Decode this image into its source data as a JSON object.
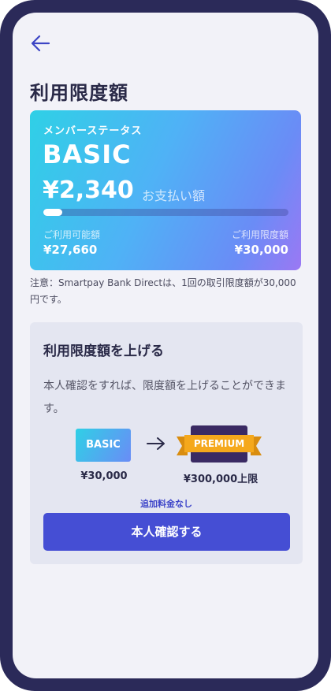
{
  "header": {
    "back_icon": "arrow-left-icon",
    "title": "利用限度額"
  },
  "card": {
    "status_label": "メンバーステータス",
    "tier": "BASIC",
    "amount": "¥2,340",
    "amount_label": "お支払い額",
    "usage_ratio": 0.078,
    "available_label": "ご利用可能額",
    "available_value": "¥27,660",
    "limit_label": "ご利用限度額",
    "limit_value": "¥30,000",
    "gradient_colors": [
      "#2fd0e6",
      "#6a8cf6",
      "#9b78f4"
    ]
  },
  "notice": "注意：Smartpay Bank Directは、1回の取引限度額が30,000円です。",
  "upgrade": {
    "title": "利用限度額を上げる",
    "description": "本人確認をすれば、限度額を上げることができます。",
    "basic_badge": "BASIC",
    "basic_price": "¥30,000",
    "premium_badge": "PREMIUM",
    "premium_price": "¥300,000上限",
    "no_fee": "追加料金なし",
    "button_label": "本人確認する"
  },
  "colors": {
    "frame": "#2b2a59",
    "background": "#f2f2f8",
    "accent": "#454ed4",
    "premium_ribbon": "#f5a81c",
    "premium_badge": "#3a2a63"
  }
}
